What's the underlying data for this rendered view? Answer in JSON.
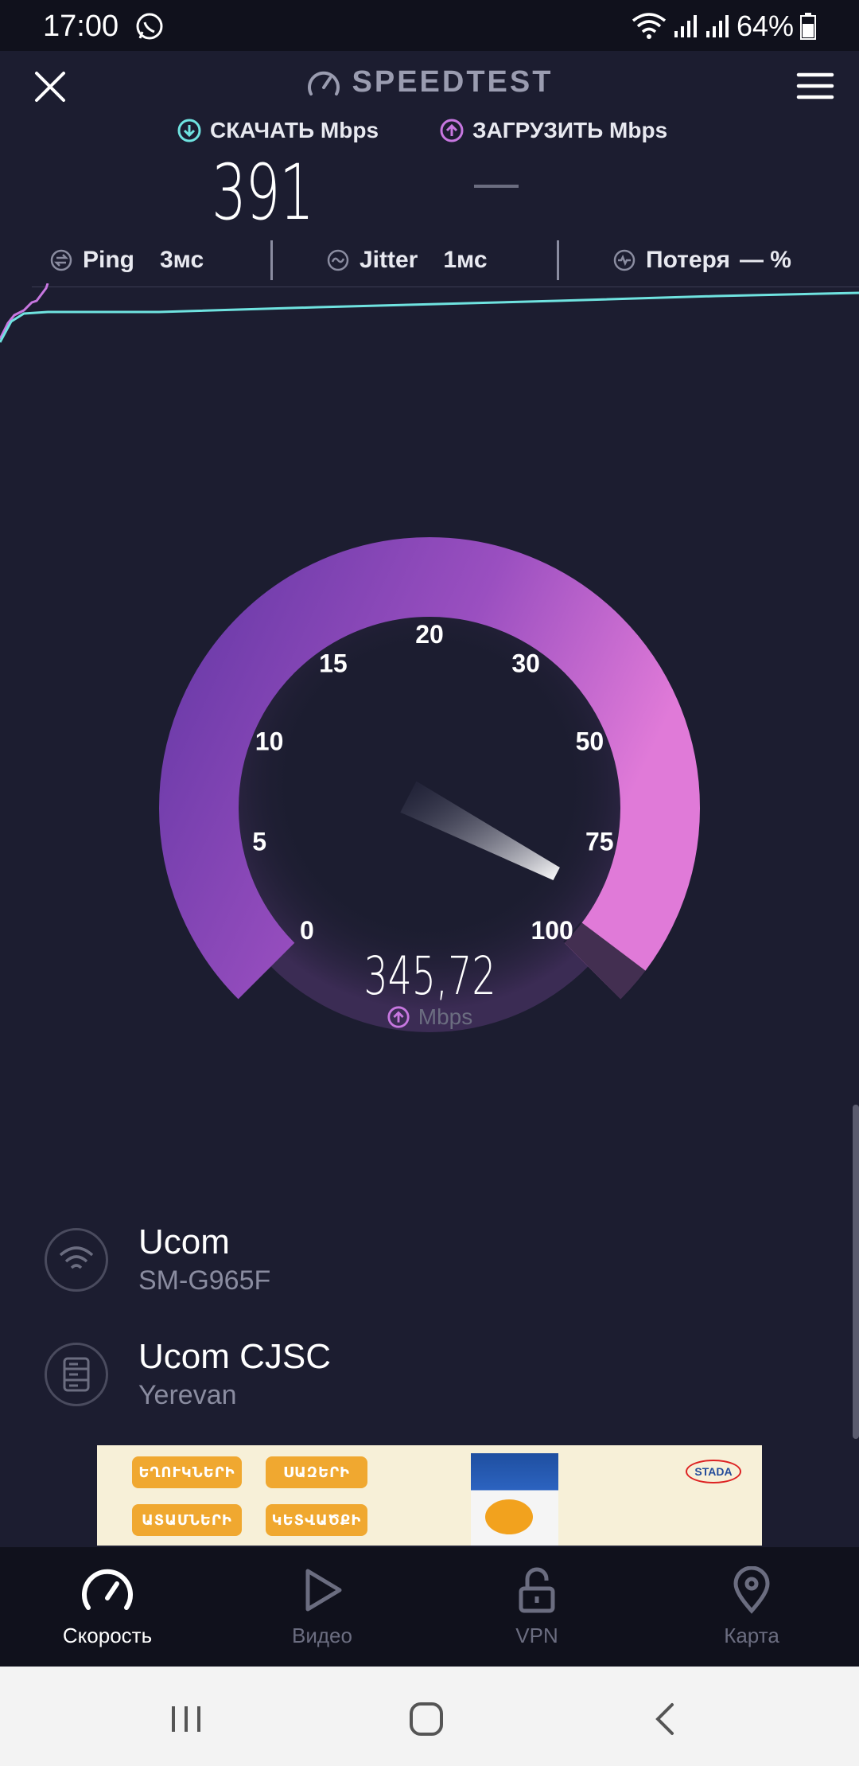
{
  "status_bar": {
    "time": "17:00",
    "battery_percent": "64%",
    "icons": [
      "whatsapp-icon",
      "wifi-icon",
      "signal-icon",
      "signal-icon",
      "battery-icon"
    ]
  },
  "header": {
    "title": "SPEEDTEST",
    "close_icon": "close-icon",
    "menu_icon": "menu-icon"
  },
  "metrics": {
    "download_label": "СКАЧАТЬ Mbps",
    "download_value": "391",
    "upload_label": "ЗАГРУЗИТЬ Mbps",
    "upload_value": "—"
  },
  "stats": {
    "ping_label": "Ping",
    "ping_value": "3мс",
    "jitter_label": "Jitter",
    "jitter_value": "1мс",
    "loss_label": "Потеря",
    "loss_value": "— %"
  },
  "gauge": {
    "ticks": [
      "0",
      "5",
      "10",
      "15",
      "20",
      "30",
      "50",
      "75",
      "100"
    ],
    "value": "345,72",
    "unit": "Mbps",
    "fill_fraction": 1.0,
    "colors": {
      "start": "#6a3aa8",
      "end": "#e07ad8",
      "needle": "#ffffff"
    }
  },
  "info": {
    "isp_name": "Ucom",
    "device": "SM-G965F",
    "server_name": "Ucom CJSC",
    "server_location": "Yerevan"
  },
  "ad": {
    "chips": [
      "ԵՂՈՒԿՆԵՐԻ",
      "ՍԱԶԵՐԻ",
      "ԱՏԱՄՆԵՐԻ",
      "ԿԵՏՎԱԾՔԻ"
    ],
    "brand": "STADA"
  },
  "tabs": [
    {
      "label": "Скорость",
      "icon": "speedometer-icon",
      "active": true
    },
    {
      "label": "Видео",
      "icon": "play-icon",
      "active": false
    },
    {
      "label": "VPN",
      "icon": "lock-open-icon",
      "active": false
    },
    {
      "label": "Карта",
      "icon": "map-pin-icon",
      "active": false
    }
  ],
  "colors": {
    "background": "#1c1d30",
    "accent_download": "#6fe3e0",
    "accent_upload": "#c777e0"
  }
}
